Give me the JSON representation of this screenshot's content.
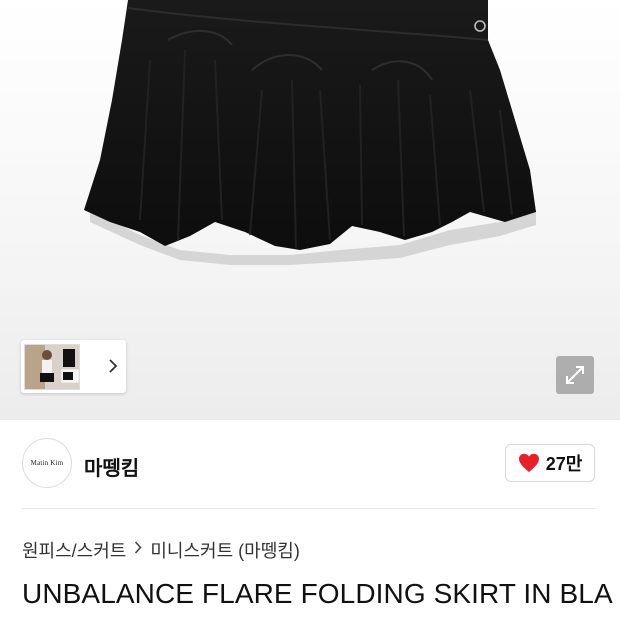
{
  "gallery": {
    "thumbnail_strip": {
      "next_icon": "chevron-right-icon"
    },
    "expand_icon": "expand-arrows-icon"
  },
  "brand": {
    "logo_text": "Matin Kim",
    "name": "마뗑킴",
    "like_icon": "heart-icon",
    "like_count": "27만",
    "heart_color": "#e8202a"
  },
  "breadcrumb": {
    "category": "원피스/스커트",
    "subcategory": "미니스커트 (마뗑킴)"
  },
  "product": {
    "title": "UNBALANCE FLARE FOLDING SKIRT IN BLA"
  }
}
